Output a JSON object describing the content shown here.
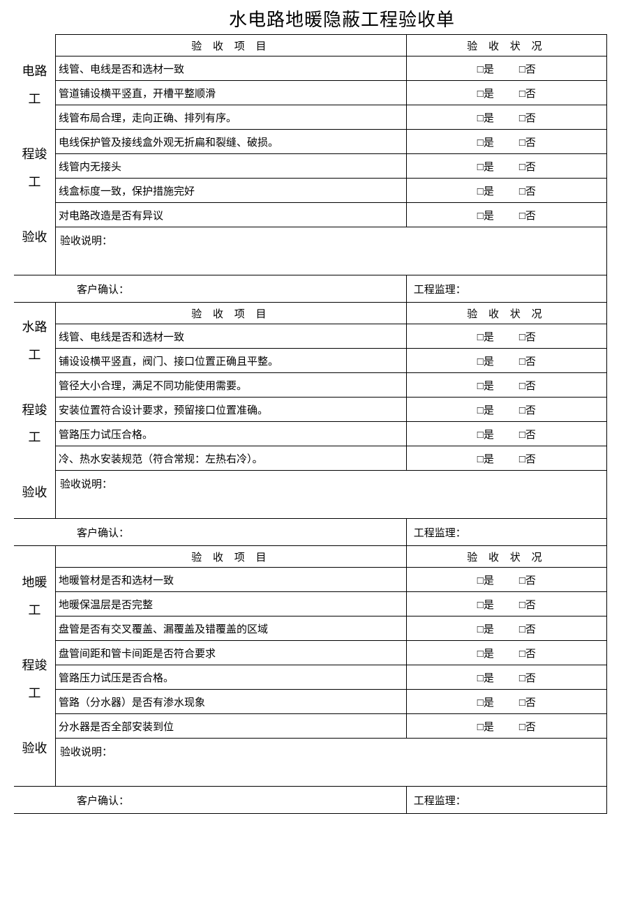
{
  "title": "水电路地暖隐蔽工程验收单",
  "hdr_item": "验 收 项 目",
  "hdr_status": "验 收 状 况",
  "yes": "□是",
  "no": "□否",
  "note_label": "验收说明：",
  "sig_customer": "客户确认：",
  "sig_supervisor": "工程监理：",
  "sections": {
    "s1": {
      "label": "电路工程竣工验收",
      "items": [
        "线管、电线是否和选材一致",
        "管道铺设横平竖直，开槽平整顺滑",
        "线管布局合理，走向正确、排列有序。",
        "电线保护管及接线盒外观无折扁和裂缝、破损。",
        "线管内无接头",
        "线盒标度一致，保护措施完好",
        "对电路改造是否有异议"
      ]
    },
    "s2": {
      "label": "水路工程竣工验收",
      "items": [
        "线管、电线是否和选材一致",
        "铺设设横平竖直，阀门、接口位置正确且平整。",
        "管径大小合理，满足不同功能使用需要。",
        "安装位置符合设计要求，预留接口位置准确。",
        "管路压力试压合格。",
        "冷、热水安装规范（符合常规：左热右冷）。"
      ]
    },
    "s3": {
      "label": "地暖工程竣工验收",
      "items": [
        "地暖管材是否和选材一致",
        "地暖保温层是否完整",
        "盘管是否有交叉覆盖、漏覆盖及错覆盖的区域",
        "盘管间距和管卡间距是否符合要求",
        "管路压力试压是否合格。",
        "管路（分水器）是否有渗水现象",
        "分水器是否全部安装到位"
      ]
    }
  }
}
